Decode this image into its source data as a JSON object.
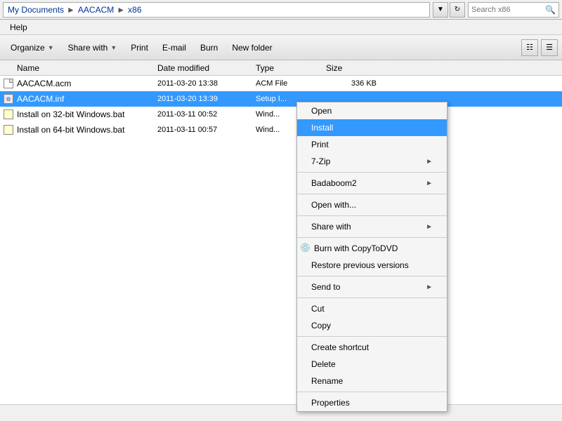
{
  "address": {
    "segments": [
      "My Documents",
      "AACACM",
      "x86"
    ],
    "search_placeholder": "Search x86"
  },
  "menu": {
    "items": [
      "Help"
    ]
  },
  "toolbar": {
    "organize_label": "Organize",
    "share_label": "Share with",
    "print_label": "Print",
    "email_label": "E-mail",
    "burn_label": "Burn",
    "new_folder_label": "New folder"
  },
  "columns": {
    "name": "Name",
    "date_modified": "Date modified",
    "type": "Type",
    "size": "Size"
  },
  "files": [
    {
      "name": "AACACM.acm",
      "date": "2011-03-20 13:38",
      "type": "ACM File",
      "size": "336 KB",
      "icon": "doc",
      "selected": false
    },
    {
      "name": "AACACM.inf",
      "date": "2011-03-20 13:39",
      "type": "Setup I...",
      "size": "",
      "icon": "inf",
      "selected": true
    },
    {
      "name": "Install on 32-bit Windows.bat",
      "date": "2011-03-11 00:52",
      "type": "Wind...",
      "size": "",
      "icon": "bat",
      "selected": false
    },
    {
      "name": "Install on 64-bit Windows.bat",
      "date": "2011-03-11 00:57",
      "type": "Wind...",
      "size": "",
      "icon": "bat",
      "selected": false
    }
  ],
  "context_menu": {
    "items": [
      {
        "label": "Open",
        "type": "item",
        "arrow": false
      },
      {
        "label": "Install",
        "type": "item-highlight",
        "arrow": false
      },
      {
        "label": "Print",
        "type": "item",
        "arrow": false
      },
      {
        "label": "7-Zip",
        "type": "item",
        "arrow": true
      },
      {
        "type": "separator"
      },
      {
        "label": "Badaboom2",
        "type": "item",
        "arrow": true
      },
      {
        "type": "separator"
      },
      {
        "label": "Open with...",
        "type": "item",
        "arrow": false
      },
      {
        "type": "separator"
      },
      {
        "label": "Share with",
        "type": "item",
        "arrow": true
      },
      {
        "type": "separator"
      },
      {
        "label": "Burn with CopyToDVD",
        "type": "item-icon",
        "arrow": false
      },
      {
        "label": "Restore previous versions",
        "type": "item",
        "arrow": false
      },
      {
        "type": "separator"
      },
      {
        "label": "Send to",
        "type": "item",
        "arrow": true
      },
      {
        "type": "separator"
      },
      {
        "label": "Cut",
        "type": "item",
        "arrow": false
      },
      {
        "label": "Copy",
        "type": "item",
        "arrow": false
      },
      {
        "type": "separator"
      },
      {
        "label": "Create shortcut",
        "type": "item",
        "arrow": false
      },
      {
        "label": "Delete",
        "type": "item",
        "arrow": false
      },
      {
        "label": "Rename",
        "type": "item",
        "arrow": false
      },
      {
        "type": "separator"
      },
      {
        "label": "Properties",
        "type": "item",
        "arrow": false
      }
    ]
  },
  "status": {
    "text": ""
  }
}
